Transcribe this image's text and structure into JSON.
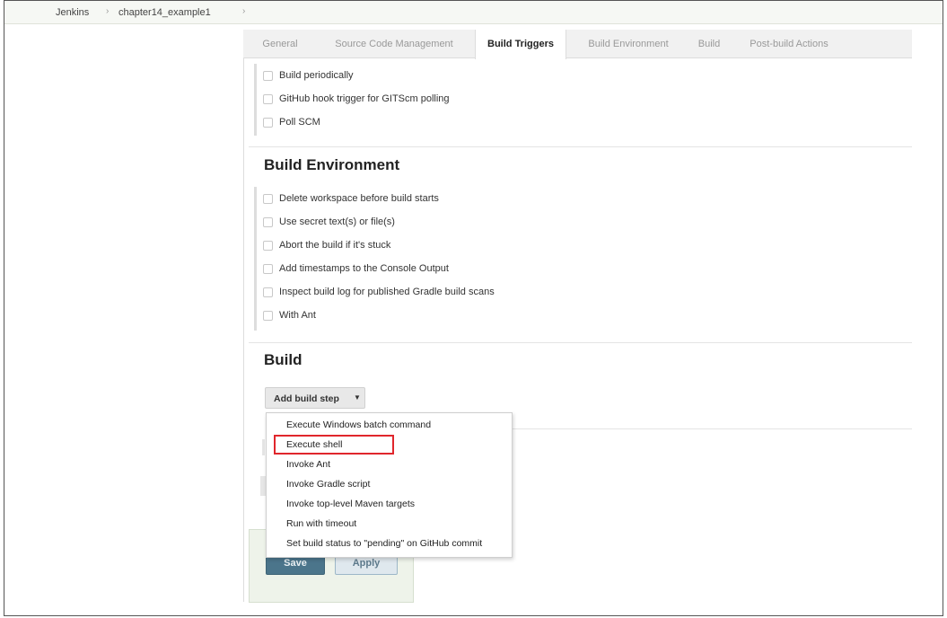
{
  "breadcrumb": {
    "root": "Jenkins",
    "job": "chapter14_example1"
  },
  "tabs": [
    "General",
    "Source Code Management",
    "Build Triggers",
    "Build Environment",
    "Build",
    "Post-build Actions"
  ],
  "active_tab": "Build Triggers",
  "build_triggers": {
    "options": [
      "Build periodically",
      "GitHub hook trigger for GITScm polling",
      "Poll SCM"
    ]
  },
  "build_environment": {
    "title": "Build Environment",
    "options": [
      "Delete workspace before build starts",
      "Use secret text(s) or file(s)",
      "Abort the build if it's stuck",
      "Add timestamps to the Console Output",
      "Inspect build log for published Gradle build scans",
      "With Ant"
    ]
  },
  "build": {
    "title": "Build",
    "add_step_label": "Add build step",
    "menu_items": [
      "Execute Windows batch command",
      "Execute shell",
      "Invoke Ant",
      "Invoke Gradle script",
      "Invoke top-level Maven targets",
      "Run with timeout",
      "Set build status to \"pending\" on GitHub commit"
    ],
    "highlighted_item": "Execute shell"
  },
  "footer": {
    "save_label": "Save",
    "apply_label": "Apply"
  },
  "colors": {
    "highlight_border": "#e0262c",
    "save_button": "#4b758b",
    "breadcrumb_bg": "#f6f8f4"
  }
}
